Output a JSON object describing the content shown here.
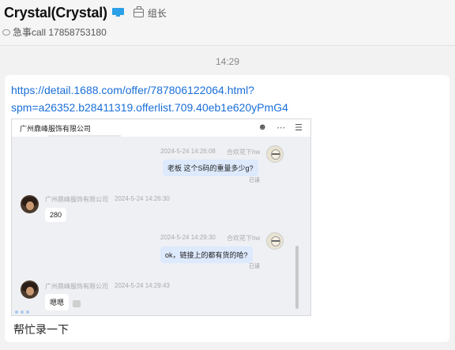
{
  "header": {
    "contact_name": "Crystal(Crystal)",
    "device_icon": "computer-monitor-icon",
    "group_icon": "briefcase-icon",
    "group_label": "组长",
    "signature_icon": "speech-bubble-icon",
    "signature": "急事call 17858753180"
  },
  "chat": {
    "time_divider": "14:29",
    "message": {
      "link_text": "https://detail.1688.com/offer/787806122064.html?\nspm=a26352.b28411319.offerlist.709.40eb1e620yPmG4",
      "caption": "帮忙录一下",
      "screenshot": {
        "title": "广州鼎峰服饰有限公司",
        "top_icons": [
          "person-icon",
          "more-dots-icon",
          "menu-icon"
        ],
        "messages": [
          {
            "side": "right",
            "time": "2024-5-24 14:26:08",
            "sender": "合欢花下hw",
            "text": "老板 这个S码的重量多少g?",
            "status": "已读"
          },
          {
            "side": "left",
            "sender": "广州鼎峰服饰有限公司",
            "time": "2024-5-24 14:26:30",
            "text": "280"
          },
          {
            "side": "right",
            "time": "2024-5-24 14:29:30",
            "sender": "合欢花下hw",
            "text": "ok，链接上的都有货的哈?",
            "status": "已读"
          },
          {
            "side": "left",
            "sender": "广州鼎峰服饰有限公司",
            "time": "2024-5-24 14:29:43",
            "text": "嗯嗯"
          }
        ]
      }
    }
  },
  "colors": {
    "link": "#1a6fd9",
    "device_icon": "#2ba0e6",
    "outgoing_bubble": "#dde9fc"
  }
}
